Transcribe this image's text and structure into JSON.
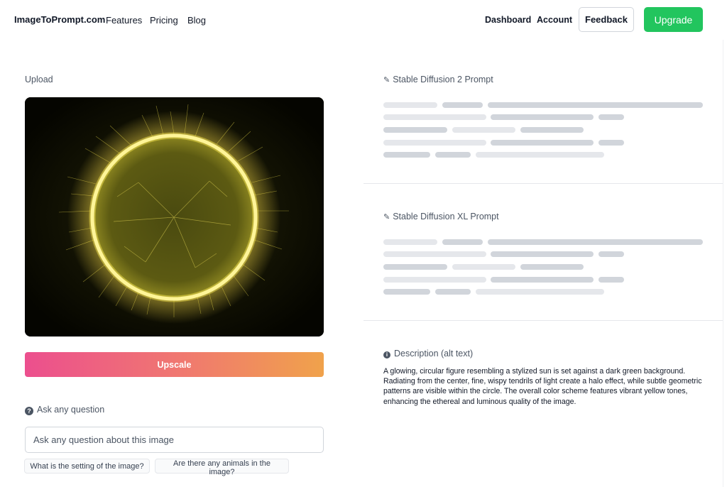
{
  "header": {
    "brand": "ImageToPrompt.com",
    "nav_links": [
      "Features",
      "Pricing",
      "Blog"
    ],
    "right_links": [
      "Dashboard",
      "Account"
    ],
    "feedback_label": "Feedback",
    "upgrade_label": "Upgrade"
  },
  "upload": {
    "label": "Upload",
    "image_description": "glowing yellow sun on dark background",
    "upscale_label": "Upscale"
  },
  "question": {
    "label": "Ask any question",
    "input_placeholder": "Ask any question about this image",
    "suggestions": [
      "What is the setting of the image?",
      "Are there any animals in the image?"
    ]
  },
  "prompts": {
    "sd2_title": "Stable Diffusion 2 Prompt",
    "sdxl_title": "Stable Diffusion XL Prompt"
  },
  "description": {
    "title": "Description (alt text)",
    "text": "A glowing, circular figure resembling a stylized sun is set against a dark green background. Radiating from the center, fine, wispy tendrils of light create a halo effect, while subtle geometric patterns are visible within the circle. The overall color scheme features vibrant yellow tones, enhancing the ethereal and luminous quality of the image."
  },
  "colors": {
    "upgrade": "#22c55e",
    "upscale_gradient_start": "#ec4f8e",
    "upscale_gradient_end": "#f0a24b",
    "sun_glow": "#ffee66"
  }
}
